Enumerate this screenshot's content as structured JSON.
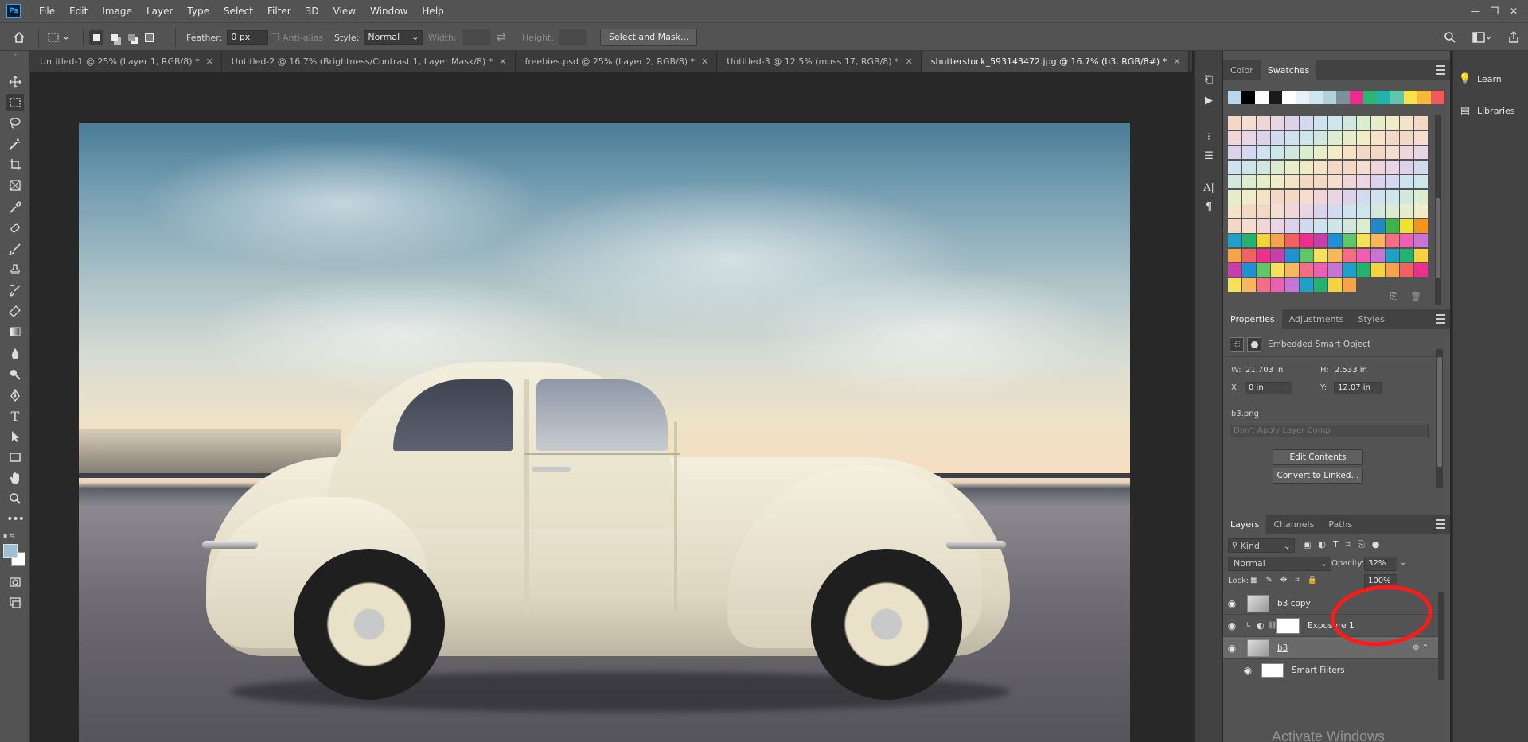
{
  "app": {
    "logo": "Ps",
    "window_controls": [
      "—",
      "❐",
      "✕"
    ]
  },
  "menu": [
    "File",
    "Edit",
    "Image",
    "Layer",
    "Type",
    "Select",
    "Filter",
    "3D",
    "View",
    "Window",
    "Help"
  ],
  "options": {
    "feather_label": "Feather:",
    "feather_value": "0 px",
    "antialias_label": "Anti-alias",
    "style_label": "Style:",
    "style_value": "Normal",
    "width_label": "Width:",
    "height_label": "Height:",
    "select_mask_label": "Select and Mask..."
  },
  "tabs": [
    {
      "label": "Untitled-1 @ 25% (Layer 1, RGB/8) *"
    },
    {
      "label": "Untitled-2 @ 16.7% (Brightness/Contrast 1, Layer Mask/8) *"
    },
    {
      "label": "freebies.psd @ 25% (Layer 2, RGB/8) *"
    },
    {
      "label": "Untitled-3 @ 12.5% (moss 17, RGB/8) *"
    },
    {
      "label": "shutterstock_593143472.jpg @ 16.7% (b3, RGB/8#) *"
    }
  ],
  "swatches_panel": {
    "tabs": [
      "Color",
      "Swatches"
    ],
    "top_row": [
      "#b9d7ea",
      "#000000",
      "#ffffff",
      "#1a1a1a",
      "#ffffff",
      "#e6f2f7",
      "#cfe6ef",
      "#b2cfdc",
      "#7d8f99",
      "#ed2b91",
      "#2bb673",
      "#1fb5ac",
      "#62c6a8",
      "#f7e24b",
      "#f9b938",
      "#f15a5a"
    ]
  },
  "properties_panel": {
    "tabs": [
      "Properties",
      "Adjustments",
      "Styles"
    ],
    "object_type": "Embedded Smart Object",
    "w_label": "W:",
    "w_value": "21.703 in",
    "h_label": "H:",
    "h_value": "2.533 in",
    "x_label": "X:",
    "x_value": "0 in",
    "y_label": "Y:",
    "y_value": "12.07 in",
    "file_name": "b3.png",
    "layer_comp": "Don't Apply Layer Comp",
    "edit_contents": "Edit Contents",
    "convert_linked": "Convert to Linked..."
  },
  "layers_panel": {
    "tabs": [
      "Layers",
      "Channels",
      "Paths"
    ],
    "filter_kind": "Kind",
    "blend_mode": "Normal",
    "opacity_label": "Opacity:",
    "opacity_value": "32%",
    "lock_label": "Lock:",
    "fill_value": "100%",
    "layers": [
      {
        "name": "b3 copy"
      },
      {
        "name": "Exposure 1"
      },
      {
        "name": "b3"
      },
      {
        "name": "Smart Filters"
      }
    ]
  },
  "learn_panel": {
    "items": [
      "Learn",
      "Libraries"
    ]
  },
  "watermark": "Activate Windows"
}
